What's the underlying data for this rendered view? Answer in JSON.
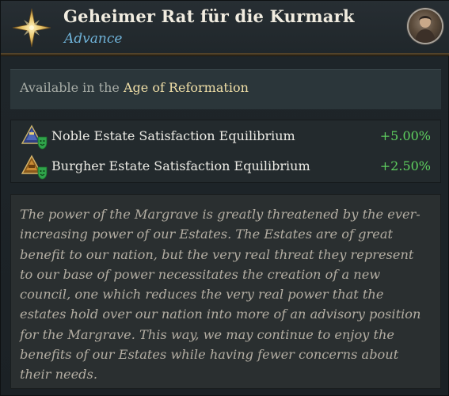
{
  "header": {
    "title": "Geheimer Rat für die Kurmark",
    "subtitle": "Advance",
    "emblem_icon": "gold-compass-star-icon",
    "portrait_icon": "ruler-portrait-icon"
  },
  "availability": {
    "prefix": "Available in the ",
    "age": "Age of Reformation"
  },
  "modifiers": [
    {
      "label": "Noble Estate Satisfaction Equilibrium",
      "value": "+5.00%",
      "icon": "noble-estate-icon"
    },
    {
      "label": "Burgher Estate Satisfaction Equilibrium",
      "value": "+2.50%",
      "icon": "burgher-estate-icon"
    }
  ],
  "description_lines": [
    "The power of the Margrave is greatly threatened by the ever-",
    "increasing power of our Estates. The Estates are of great",
    "benefit to our nation, but the very real threat they represent",
    "to our base of power necessitates the creation of a new",
    "council, one which reduces the very real power that the",
    "estates hold over our nation into more of an advisory position",
    " for the Margrave. This way, we may continue to enjoy the",
    "benefits of our Estates while having fewer concerns about",
    "their needs."
  ],
  "colors": {
    "title": "#f1ece0",
    "subtitle": "#6fb3d9",
    "age_highlight": "#f0dfa7",
    "positive_value": "#5fd05f",
    "description": "#b3ada2"
  }
}
